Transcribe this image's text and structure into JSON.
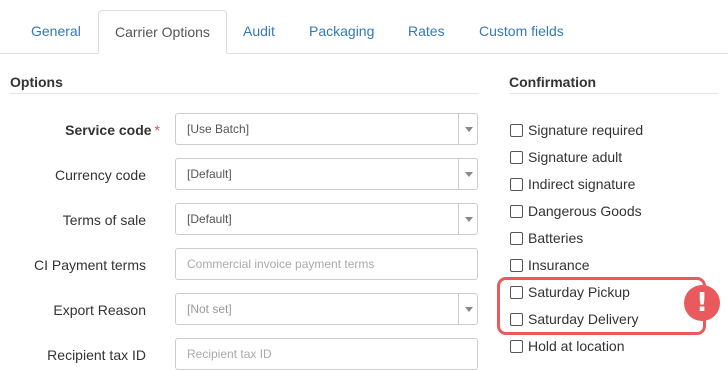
{
  "tabs": [
    {
      "label": "General"
    },
    {
      "label": "Carrier Options"
    },
    {
      "label": "Audit"
    },
    {
      "label": "Packaging"
    },
    {
      "label": "Rates"
    },
    {
      "label": "Custom fields"
    }
  ],
  "active_tab": "Carrier Options",
  "options": {
    "title": "Options",
    "service_code": {
      "label": "Service code",
      "required_mark": "*",
      "value": "[Use Batch]"
    },
    "currency_code": {
      "label": "Currency code",
      "value": "[Default]"
    },
    "terms_of_sale": {
      "label": "Terms of sale",
      "value": "[Default]"
    },
    "ci_payment_terms": {
      "label": "CI Payment terms",
      "placeholder": "Commercial invoice payment terms"
    },
    "export_reason": {
      "label": "Export Reason",
      "value": "[Not set]"
    },
    "recipient_tax_id": {
      "label": "Recipient tax ID",
      "placeholder": "Recipient tax ID"
    }
  },
  "confirmation": {
    "title": "Confirmation",
    "items": [
      {
        "label": "Signature required",
        "checked": false
      },
      {
        "label": "Signature adult",
        "checked": false
      },
      {
        "label": "Indirect signature",
        "checked": false
      },
      {
        "label": "Dangerous Goods",
        "checked": false
      },
      {
        "label": "Batteries",
        "checked": false
      },
      {
        "label": "Insurance",
        "checked": false
      },
      {
        "label": "Saturday Pickup",
        "checked": false
      },
      {
        "label": "Saturday Delivery",
        "checked": false
      },
      {
        "label": "Hold at location",
        "checked": false
      }
    ]
  },
  "annotation": {
    "icon": "exclamation-icon",
    "symbol": "!",
    "color": "#ea5a5c"
  }
}
